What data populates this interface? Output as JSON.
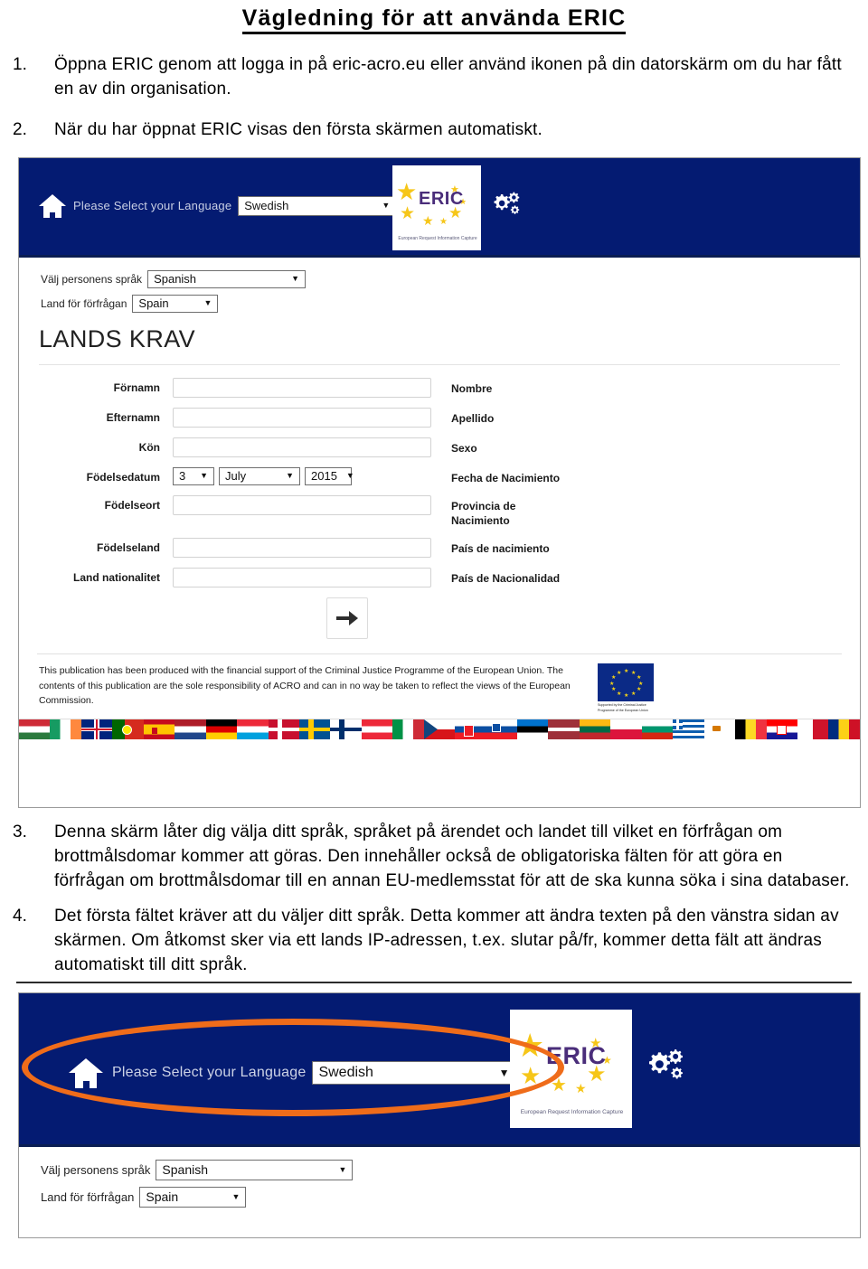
{
  "document": {
    "title": "Vägledning för att använda ERIC",
    "steps": [
      {
        "num": "1.",
        "text": "Öppna ERIC genom att logga in på eric-acro.eu eller använd ikonen på din datorskärm om du har fått en av din organisation."
      },
      {
        "num": "2.",
        "text": "När du har öppnat ERIC visas den första skärmen automatiskt."
      },
      {
        "num": "3.",
        "text": "Denna skärm låter dig välja ditt språk, språket på ärendet och landet till vilket en förfrågan om brottmålsdomar kommer att göras. Den innehåller också de obligatoriska fälten för att göra en förfrågan om brottmålsdomar till en annan EU-medlemsstat för att de ska kunna söka i sina databaser."
      },
      {
        "num": "4.",
        "text": "Det första fältet kräver att du väljer ditt språk. Detta kommer att ändra texten på den vänstra sidan av skärmen. Om åtkomst sker via ett lands IP-adressen, t.ex. slutar på/fr, kommer detta fält att ändras automatiskt till ditt språk."
      }
    ]
  },
  "screenshot1": {
    "header": {
      "home_icon": "home-icon",
      "language_label": "Please Select your Language",
      "language_value": "Swedish",
      "gear_icon": "gears-icon",
      "logo": {
        "word": "ERIC",
        "tagline": "European Request Information Capture"
      },
      "background_color": "#041b72"
    },
    "selectors": [
      {
        "label": "Välj personens språk",
        "value": "Spanish"
      },
      {
        "label": "Land för förfrågan",
        "value": "Spain"
      }
    ],
    "section_heading": "LANDS KRAV",
    "fields": [
      {
        "sv": "Förnamn",
        "es": "Nombre",
        "type": "text"
      },
      {
        "sv": "Efternamn",
        "es": "Apellido",
        "type": "text"
      },
      {
        "sv": "Kön",
        "es": "Sexo",
        "type": "text"
      },
      {
        "sv": "Födelsedatum",
        "es": "Fecha de Nacimiento",
        "type": "date"
      },
      {
        "sv": "Födelseort",
        "es": "Provincia de Nacimiento",
        "type": "text"
      },
      {
        "sv": "Födelseland",
        "es": "País de nacimiento",
        "type": "text"
      },
      {
        "sv": "Land nationalitet",
        "es": "País de Nacionalidad",
        "type": "text"
      }
    ],
    "date_of_birth": {
      "day": "3",
      "month": "July",
      "year": "2015"
    },
    "next_button": "arrow-right-icon",
    "footer": {
      "disclaimer": "This publication has been produced with the financial support of the Criminal Justice Programme of the European Union. The contents of this publication are the sole responsibility of ACRO and can in no way be taken to reflect the views of the European Commission.",
      "eu_emblem_caption": "Supported by the Criminal Justice Programme of the European Union"
    },
    "flag_strip": [
      "Hungary",
      "Ireland",
      "United Kingdom",
      "Portugal",
      "Spain",
      "Netherlands",
      "Germany",
      "Luxembourg",
      "Denmark",
      "Sweden",
      "Finland",
      "Austria",
      "Italy",
      "Czech Republic",
      "Slovakia",
      "Slovenia",
      "Estonia",
      "Latvia",
      "Lithuania",
      "Poland",
      "Bulgaria",
      "Greece",
      "Cyprus",
      "Belgium",
      "Croatia",
      "Malta",
      "Romania"
    ]
  },
  "screenshot2": {
    "header": {
      "home_icon": "home-icon",
      "language_label": "Please Select your Language",
      "language_value": "Swedish",
      "gear_icon": "gears-icon",
      "logo": {
        "word": "ERIC",
        "tagline": "European Request Information Capture"
      },
      "highlight": "orange-ellipse-annotation",
      "highlight_color": "#ef6c1a"
    },
    "selectors": [
      {
        "label": "Välj personens språk",
        "value": "Spanish"
      },
      {
        "label": "Land för förfrågan",
        "value": "Spain"
      }
    ]
  }
}
